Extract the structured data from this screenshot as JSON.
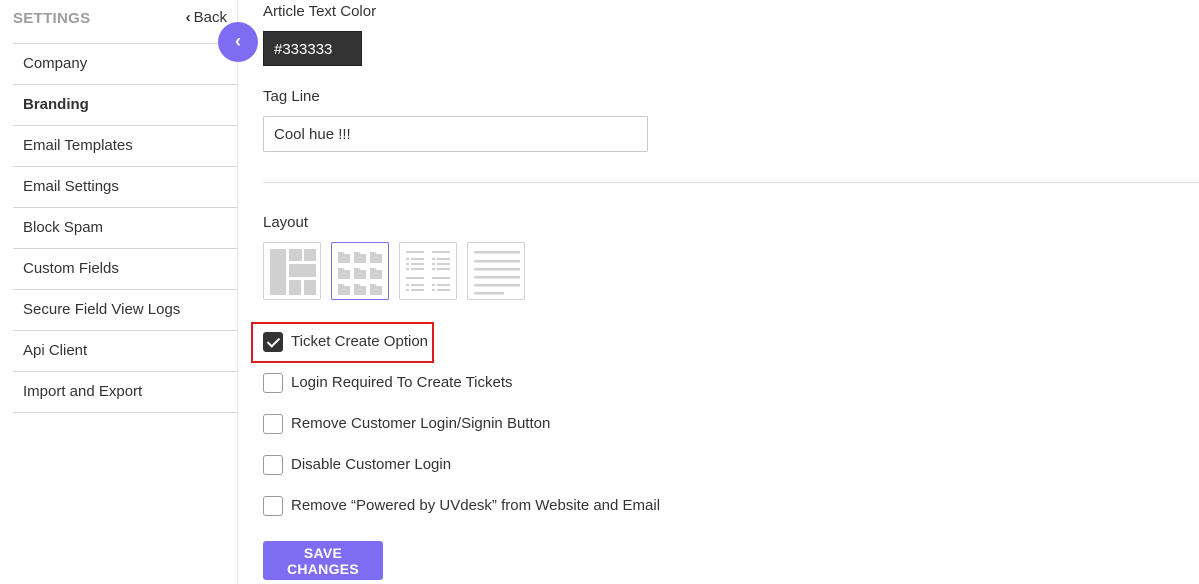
{
  "sidebar": {
    "title": "SETTINGS",
    "back_label": "Back",
    "items": [
      {
        "label": "Company",
        "active": false
      },
      {
        "label": "Branding",
        "active": true
      },
      {
        "label": "Email Templates",
        "active": false
      },
      {
        "label": "Email Settings",
        "active": false
      },
      {
        "label": "Block Spam",
        "active": false
      },
      {
        "label": "Custom Fields",
        "active": false
      },
      {
        "label": "Secure Field View Logs",
        "active": false
      },
      {
        "label": "Api Client",
        "active": false
      },
      {
        "label": "Import and Export",
        "active": false
      }
    ]
  },
  "collapse_icon": "chevron-left-icon",
  "form": {
    "article_text_color_label": "Article Text Color",
    "article_text_color_value": "#333333",
    "tag_line_label": "Tag Line",
    "tag_line_value": "Cool hue !!!",
    "layout_label": "Layout",
    "layout_options": [
      {
        "name": "masonry-layout",
        "selected": false
      },
      {
        "name": "folder-grid-layout",
        "selected": true
      },
      {
        "name": "list-columns-layout",
        "selected": false
      },
      {
        "name": "lines-layout",
        "selected": false
      }
    ],
    "checkboxes": [
      {
        "label": "Ticket Create Option",
        "checked": true
      },
      {
        "label": "Login Required To Create Tickets",
        "checked": false
      },
      {
        "label": "Remove Customer Login/Signin Button",
        "checked": false
      },
      {
        "label": "Disable Customer Login",
        "checked": false
      },
      {
        "label": "Remove “Powered by UVdesk” from Website and Email",
        "checked": false
      }
    ],
    "save_label": "SAVE CHANGES"
  },
  "colors": {
    "accent": "#7e6cf2",
    "highlight": "#e0191e",
    "article_text": "#333333"
  }
}
